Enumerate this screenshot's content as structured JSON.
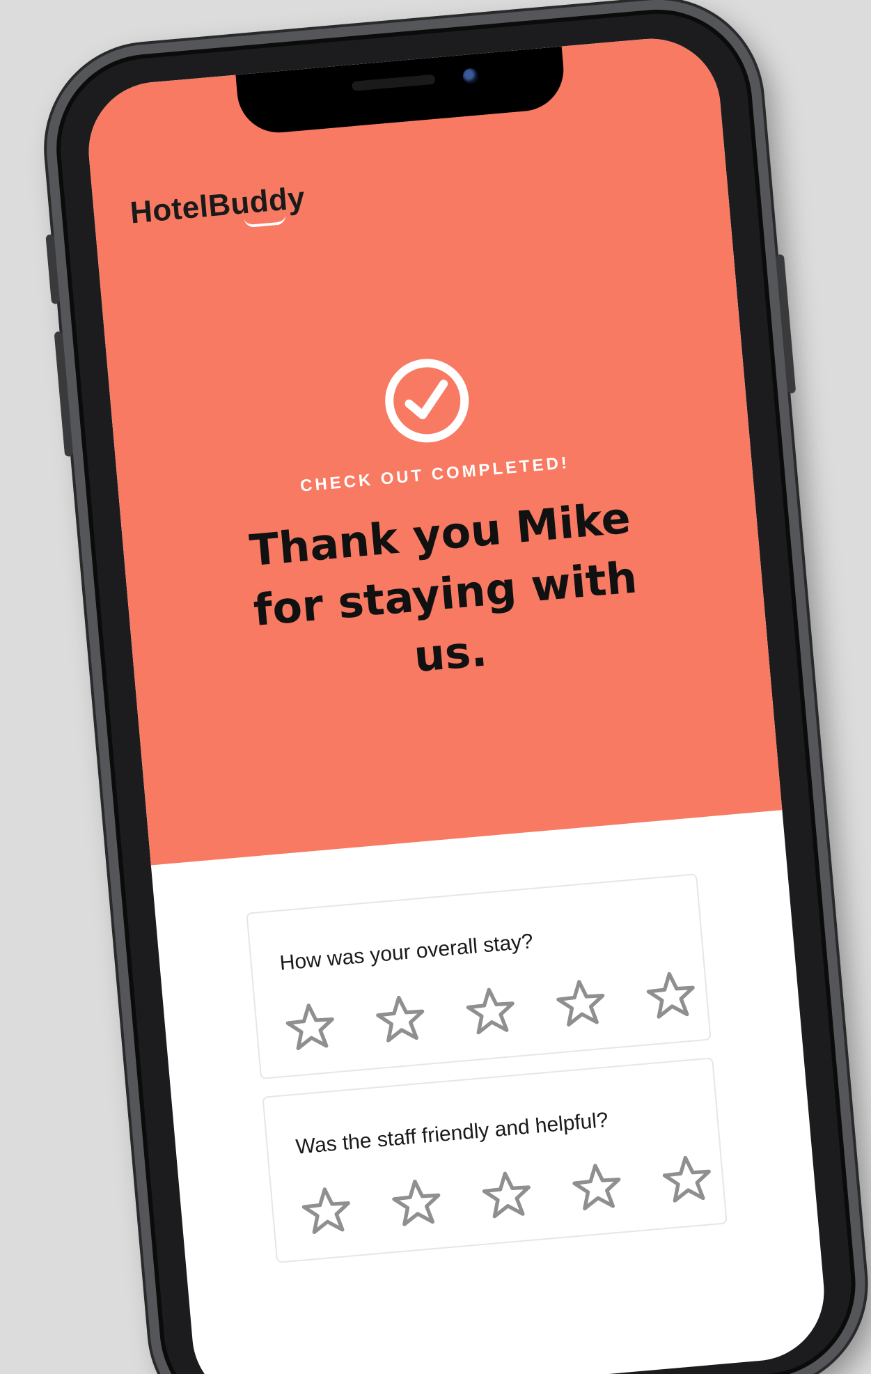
{
  "app": {
    "logo": "HotelBuddy",
    "brand_color": "#f87a62"
  },
  "confirmation": {
    "icon": "check-circle-icon",
    "eyebrow": "CHECK OUT COMPLETED!",
    "headline": "Thank you Mike for staying with us."
  },
  "survey": {
    "questions": [
      {
        "label": "How was your overall stay?",
        "rating": 0,
        "max": 5
      },
      {
        "label": "Was the staff friendly and helpful?",
        "rating": 0,
        "max": 5
      }
    ],
    "star_icon": "star-outline-icon"
  }
}
